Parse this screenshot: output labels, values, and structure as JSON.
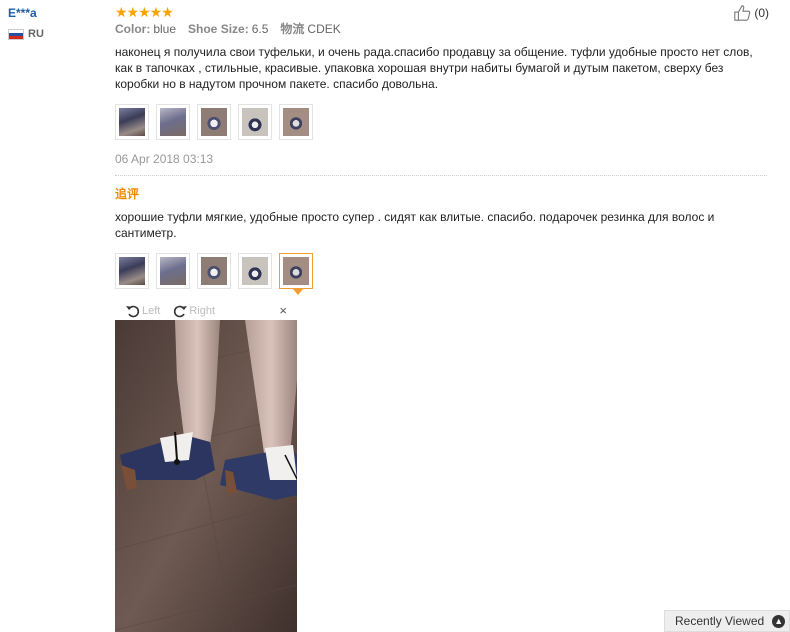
{
  "user": {
    "name": "E***a",
    "country": "RU"
  },
  "review": {
    "stars": "★★★★★",
    "color_label": "Color:",
    "color_value": "blue",
    "size_label": "Shoe Size:",
    "size_value": "6.5",
    "shipping_label": "物流",
    "shipping_value": "CDEK",
    "helpful_count": "(0)",
    "text": "наконец я получила свои туфельки, и очень рада.спасибо продавцу за общение. туфли удобные просто нет слов, как в тапочках , стильные, красивые. упаковка хорошая внутри набиты бумагой и дутым пакетом, сверху без коробки но в надутом прочном пакете. спасибо довольна.",
    "date": "06 Apr 2018 03:13"
  },
  "followup": {
    "label": "追评",
    "text": "хорошие туфли мягкие, удобные просто супер . сидят как влитые. спасибо. подарочек резинка для волос и сантиметр."
  },
  "viewer": {
    "rotate_left": "Left",
    "rotate_right": "Right",
    "close": "×"
  },
  "recently_viewed": {
    "label": "Recently Viewed"
  },
  "colors": {
    "accent": "#f39c32",
    "stars": "#f7a400",
    "link": "#1d5fa6"
  }
}
